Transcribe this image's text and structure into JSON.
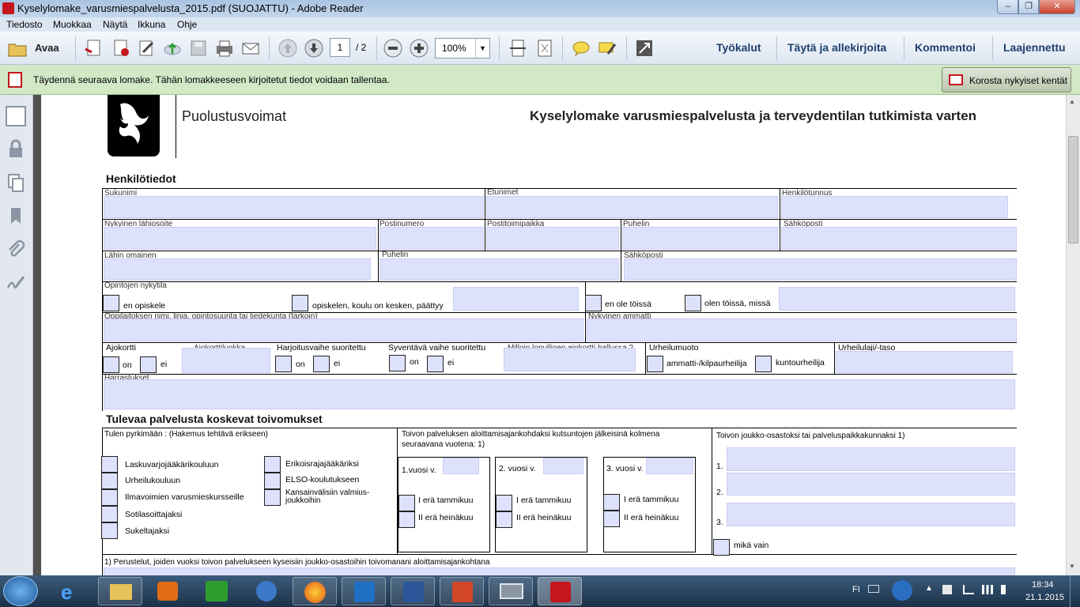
{
  "window": {
    "title": "Kyselylomake_varusmiespalvelusta_2015.pdf (SUOJATTU) - Adobe Reader",
    "min": "–",
    "max": "❐",
    "close": "✕"
  },
  "menu": [
    "Tiedosto",
    "Muokkaa",
    "Näytä",
    "Ikkuna",
    "Ohje"
  ],
  "toolbar": {
    "open": "Avaa",
    "page_current": "1",
    "page_total": "/ 2",
    "zoom": "100%",
    "links": [
      "Työkalut",
      "Täytä ja allekirjoita",
      "Kommentoi",
      "Laajennettu"
    ]
  },
  "notice": {
    "text": "Täydennä seuraava lomake. Tähän lomakkeeseen kirjoitetut tiedot voidaan tallentaa.",
    "button": "Korosta nykyiset kentät"
  },
  "form": {
    "org": "Puolustusvoimat",
    "title": "Kyselylomake varusmiespalvelusta ja terveydentilan tutkimista varten",
    "sec1": "Henkilötiedot",
    "labels": {
      "sukunimi": "Sukunimi",
      "etunimet": "Etunimet",
      "htunnus": "Henkilötunnus",
      "osoite": "Nykyinen lähiosoite",
      "postinumero": "Postinumero",
      "postitoimipaikka": "Postitoimipaikka",
      "puhelin": "Puhelin",
      "sahkoposti": "Sähköposti",
      "omainen": "Lähin omainen",
      "puhelin2": "Puhelin",
      "sahkoposti2": "Sähköposti",
      "opinnot": "Opintojen nykytila",
      "en_opiskele": "en opiskele",
      "opiskelen": "opiskelen, koulu on kesken, päättyy",
      "en_toissa": "en ole töissä",
      "olen_toissa": "olen töissä, missä",
      "oppilaitos": "Oppilaitoksen nimi, linja, opintosuunta tai tiedekunta (tarkoin)",
      "ammatti": "Nykyinen ammatti",
      "ajokortti": "Ajokortti",
      "on": "on",
      "ei": "ei",
      "ajokorttiluokka": "Ajokorttiluokka",
      "harjoitus": "Harjoitusvaihe suoritettu",
      "syventava": "Syventävä vaihe suoritettu",
      "milloin": "Milloin lopullinen ajokortti hallussa ?",
      "urheilumuoto": "Urheilumuoto",
      "ammatti_kilpa": "ammatti-/kilpaurheilija",
      "kuntourheilija": "kuntourheilija",
      "urheilulaji": "Urheilulaji/-taso",
      "harrastukset": "Harrastukset"
    },
    "sec2": "Tulevaa palvelusta koskevat toivomukset",
    "pyrkimaan": "Tulen pyrkimään : (Hakemus tehtävä erikseen)",
    "options_left": [
      "Laskuvarjojääkärikouluun",
      "Urheilukouluun",
      "Ilmavoimien varusmieskursseille",
      "Sotilasoittajaksi",
      "Sukeltajaksi"
    ],
    "options_mid": [
      "Erikoisrajajääkäriksi",
      "ELSO-koulutukseen",
      "Kansainvälisiin valmius-joukkoihin"
    ],
    "toivon_aloitus": "Toivon palveluksen aloittamisajankohdaksi kutsuntojen jälkeisinä kolmena seuraavana vuotena: 1)",
    "years": [
      "1.vuosi v.",
      "2. vuosi v.",
      "3. vuosi v."
    ],
    "era1": "I erä tammikuu",
    "era2": "II erä heinäkuu",
    "toivon_joukko": "Toivon joukko-osastoksi tai palveluspaikkakunnaksi 1)",
    "nums": [
      "1.",
      "2.",
      "3."
    ],
    "mika_vain": "mikä vain",
    "footnote": "1) Perustelut, joiden vuoksi toivon palvelukseen kyseisiin joukko-osastoihin toivomanani aloittamisajankohtana"
  },
  "taskbar": {
    "lang": "FI",
    "time": "18:34",
    "date": "21.1.2015"
  },
  "icons": [
    "pdf-icon",
    "folder-icon",
    "print-icon",
    "mail-icon",
    "save-icon",
    "zoom-out-icon",
    "zoom-in-icon",
    "comment-icon",
    "fullscreen-icon"
  ]
}
